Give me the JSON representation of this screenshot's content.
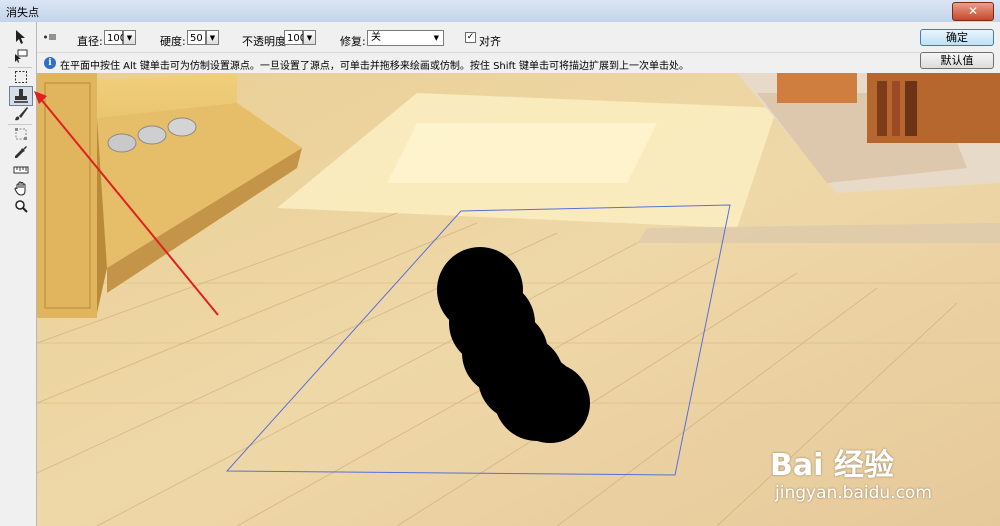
{
  "window": {
    "title": "消失点",
    "close_glyph": "✕"
  },
  "tools": [
    {
      "name": "edit-plane-tool-icon",
      "active": false
    },
    {
      "name": "create-plane-tool-icon",
      "active": false
    },
    {
      "name": "marquee-tool-icon",
      "active": false
    },
    {
      "name": "stamp-tool-icon",
      "active": true
    },
    {
      "name": "brush-tool-icon",
      "active": false
    },
    {
      "name": "transform-tool-icon",
      "active": false
    },
    {
      "name": "eyedropper-tool-icon",
      "active": false
    },
    {
      "name": "measure-tool-icon",
      "active": false
    },
    {
      "name": "hand-tool-icon",
      "active": false
    },
    {
      "name": "zoom-tool-icon",
      "active": false
    }
  ],
  "options": {
    "diameter_label": "直径:",
    "diameter_value": "100",
    "hardness_label": "硬度:",
    "hardness_value": "50",
    "opacity_label": "不透明度:",
    "opacity_value": "100",
    "heal_label": "修复:",
    "heal_value": "关",
    "align_label": "对齐",
    "align_checked": "✓"
  },
  "info": {
    "text": "在平面中按住 Alt 键单击可为仿制设置源点。一旦设置了源点，可单击并拖移来绘画或仿制。按住 Shift 键单击可将描边扩展到上一次单击处。"
  },
  "buttons": {
    "ok": "确定",
    "default": "默认值"
  },
  "watermark": {
    "brand": "Bai 经验",
    "url": "jingyan.baidu.com"
  },
  "colors": {
    "plane_outline": "#5a6fd8",
    "arrow": "#e02020",
    "paint": "#000000"
  }
}
